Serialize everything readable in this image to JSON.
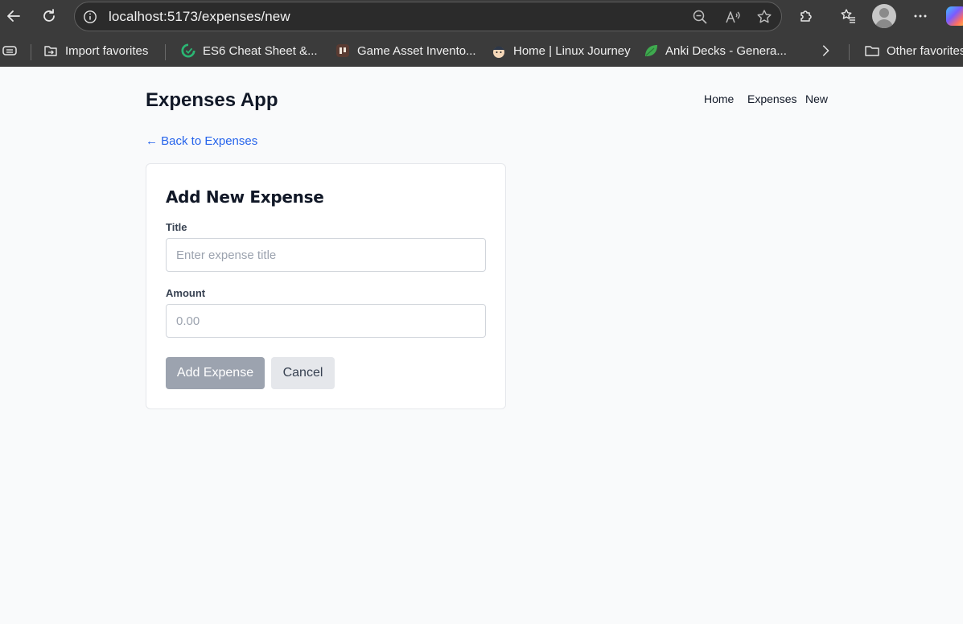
{
  "browser": {
    "url": "localhost:5173/expenses/new",
    "bookmarks": [
      {
        "label": "Import favorites",
        "icon": "import-icon"
      },
      {
        "label": "ES6 Cheat Sheet &...",
        "icon": "es6-site-icon"
      },
      {
        "label": "Game Asset Invento...",
        "icon": "game-asset-site-icon"
      },
      {
        "label": "Home | Linux Journey",
        "icon": "linux-journey-site-icon"
      },
      {
        "label": "Anki Decks - Genera...",
        "icon": "anki-leaf-icon"
      }
    ],
    "other_favorites": "Other favorites"
  },
  "app": {
    "title": "Expenses App",
    "nav": [
      "Home",
      "Expenses",
      "New"
    ],
    "back_link": "← Back to Expenses"
  },
  "form": {
    "heading": "Add New Expense",
    "title_label": "Title",
    "title_placeholder": "Enter expense title",
    "title_value": "",
    "amount_label": "Amount",
    "amount_placeholder": "0.00",
    "amount_value": "",
    "submit_label": "Add Expense",
    "cancel_label": "Cancel"
  },
  "colors": {
    "link": "#2563eb",
    "submit_disabled_bg": "#9ca3af",
    "cancel_bg": "#e5e7eb",
    "chrome_bg": "#3b3b3b"
  }
}
